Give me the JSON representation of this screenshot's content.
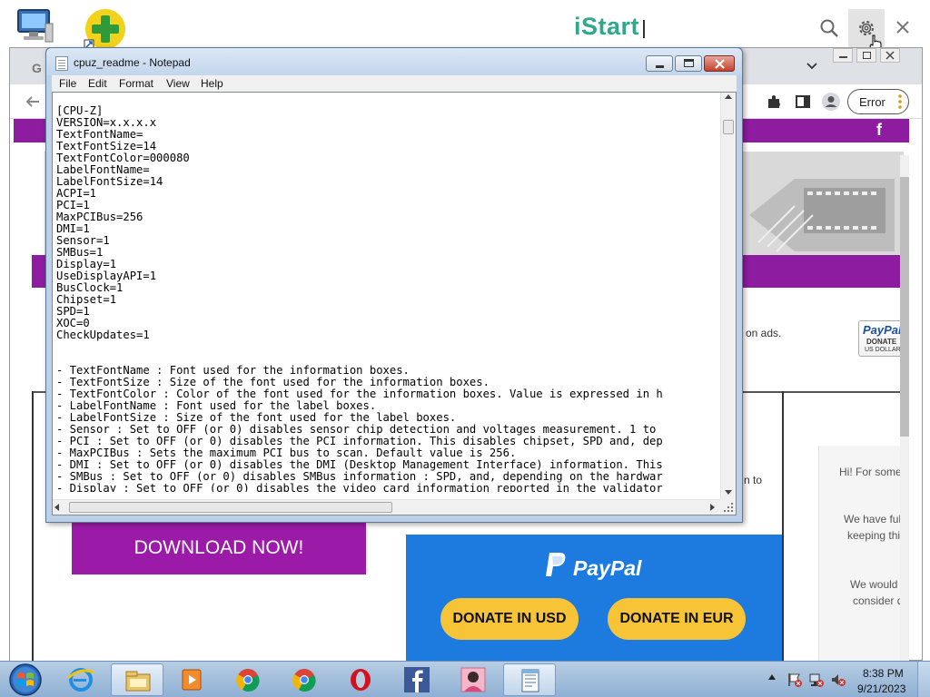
{
  "istart": {
    "logo": "iStart"
  },
  "browser": {
    "tab_fragment": "G",
    "error_label": "Error"
  },
  "page": {
    "ads_text": "on ads.",
    "to_fragment": "n to",
    "download_label": "DOWNLOAD NOW!",
    "paypal_name": "PayPal",
    "donate_usd": "DONATE IN USD",
    "donate_eur": "DONATE IN EUR",
    "paypal_small": {
      "name": "PayPal",
      "donate": "DONATE",
      "currency": "US DOLLAR"
    },
    "chat": [
      "Hi! For some re",
      "We have full r",
      "keeping this w",
      "We would ap",
      "consider dor"
    ]
  },
  "notepad": {
    "title": "cpuz_readme - Notepad",
    "menu": [
      "File",
      "Edit",
      "Format",
      "View",
      "Help"
    ],
    "lines": [
      "[CPU-Z]",
      "VERSION=x.x.x.x",
      "TextFontName=",
      "TextFontSize=14",
      "TextFontColor=000080",
      "LabelFontName=",
      "LabelFontSize=14",
      "ACPI=1",
      "PCI=1",
      "MaxPCIBus=256",
      "DMI=1",
      "Sensor=1",
      "SMBus=1",
      "Display=1",
      "UseDisplayAPI=1",
      "BusClock=1",
      "Chipset=1",
      "SPD=1",
      "XOC=0",
      "CheckUpdates=1",
      "",
      "",
      "- TextFontName : Font used for the information boxes.",
      "- TextFontSize : Size of the font used for the information boxes.",
      "- TextFontColor : Color of the font used for the information boxes. Value is expressed in h",
      "- LabelFontName : Font used for the label boxes.",
      "- LabelFontSize : Size of the font used for the label boxes.",
      "- Sensor : Set to OFF (or 0) disables sensor chip detection and voltages measurement. 1 to",
      "- PCI : Set to OFF (or 0) disables the PCI information. This disables chipset, SPD and, dep",
      "- MaxPCIBus : Sets the maximum PCI bus to scan. Default value is 256.",
      "- DMI : Set to OFF (or 0) disables the DMI (Desktop Management Interface) information. This",
      "- SMBus : Set to OFF (or 0) disables SMBus information : SPD, and, depending on the hardwar",
      "- Display : Set to OFF (or 0) disables the video card information reported in the validator"
    ]
  },
  "taskbar": {
    "time": "8:38 PM",
    "date": "9/21/2023",
    "items": [
      "internet-explorer",
      "file-explorer",
      "media-player",
      "chrome",
      "chrome-alt",
      "opera",
      "facebook",
      "photo-app",
      "notepad"
    ]
  },
  "colors": {
    "purple": "#8e1ca0",
    "paypal_blue": "#1d7be0",
    "donate_yellow": "#f7c437",
    "istart_green": "#2fa88e"
  }
}
